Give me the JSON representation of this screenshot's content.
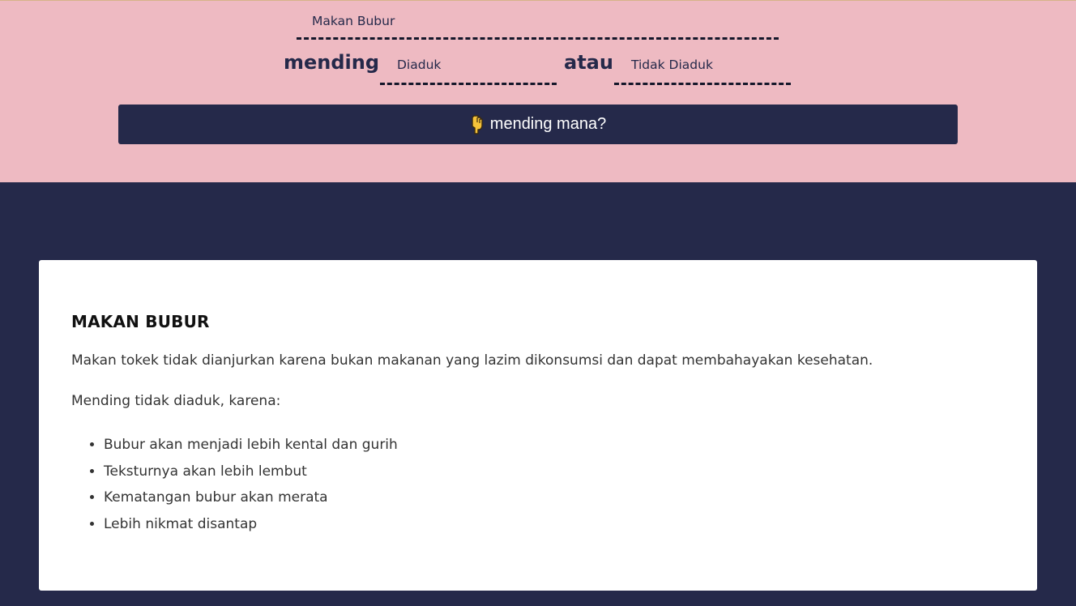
{
  "form": {
    "topic_value": "Makan Bubur",
    "mending_label": "mending",
    "option_a_value": "Diaduk",
    "atau_label": "atau",
    "option_b_value": "Tidak Diaduk",
    "ask_button_label": "mending mana?",
    "ask_button_icon": "pointing-down-hand-icon"
  },
  "result": {
    "title": "MAKAN BUBUR",
    "paragraph_1": "Makan tokek tidak dianjurkan karena bukan makanan yang lazim dikonsumsi dan dapat membahayakan kesehatan.",
    "paragraph_2": "Mending tidak diaduk, karena:",
    "reasons": [
      "Bubur akan menjadi lebih kental dan gurih",
      "Teksturnya akan lebih lembut",
      "Kematangan bubur akan merata",
      "Lebih nikmat disantap"
    ]
  },
  "colors": {
    "top_background": "#eebac2",
    "navy": "#25294a",
    "card_background": "#ffffff"
  }
}
